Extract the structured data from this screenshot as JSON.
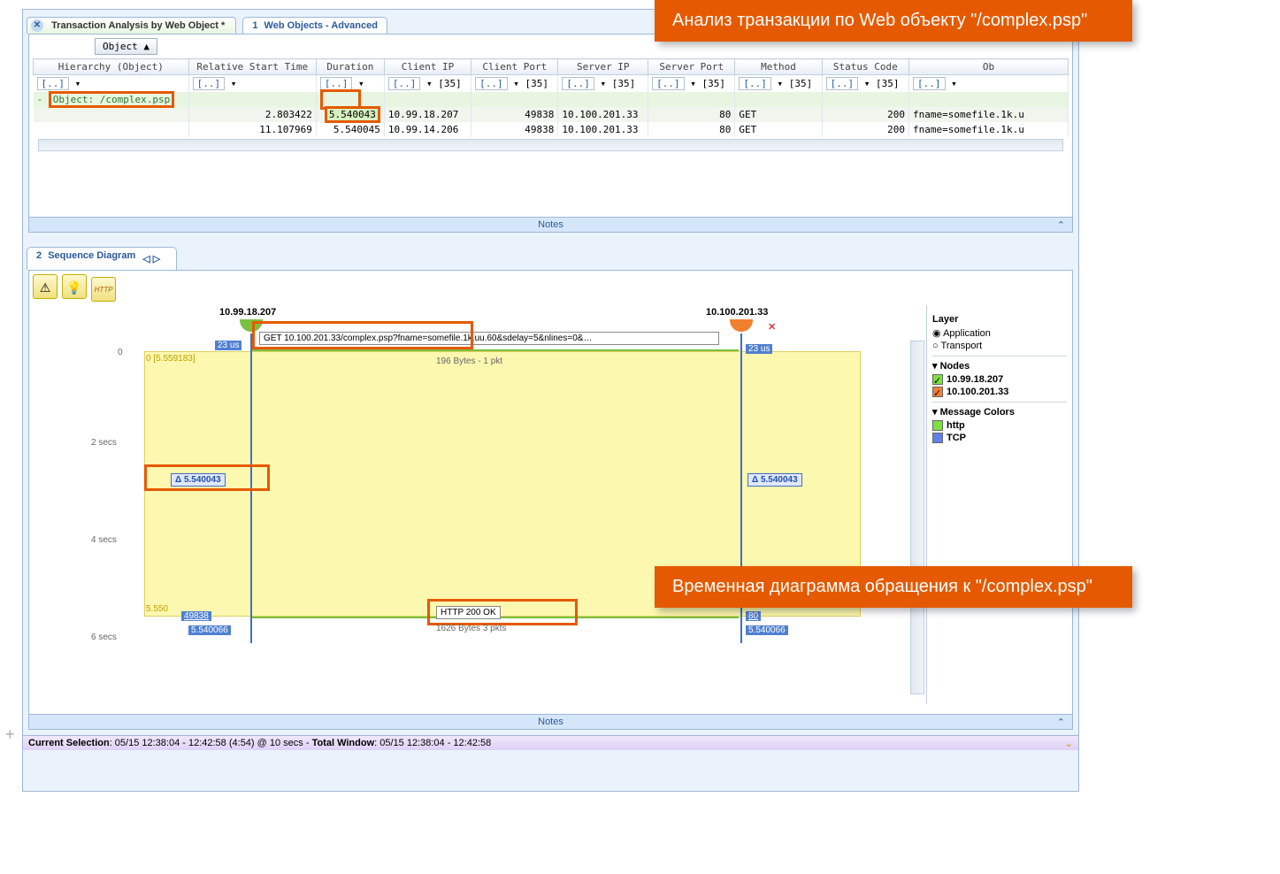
{
  "window_title": "Transaction Analysis by Web Object *",
  "panel1": {
    "tab_num": "1",
    "tab_label": "Web Objects - Advanced",
    "group_by": "Object  ▲",
    "columns": [
      "Hierarchy (Object)",
      "Relative Start Time",
      "Duration",
      "Client IP",
      "Client Port",
      "Server IP",
      "Server Port",
      "Method",
      "Status Code",
      "Ob"
    ],
    "filter_counts": [
      "",
      "",
      "",
      "[35]",
      "[35]",
      "[35]",
      "[35]",
      "[35]",
      "[35]",
      ""
    ],
    "group_row": "Object: /complex.psp",
    "rows": [
      {
        "rst": "2.803422",
        "dur": "5.540043",
        "cip": "10.99.18.207",
        "cport": "49838",
        "sip": "10.100.201.33",
        "sport": "80",
        "method": "GET",
        "status": "200",
        "obj": "fname=somefile.1k.u"
      },
      {
        "rst": "11.107969",
        "dur": "5.540045",
        "cip": "10.99.14.206",
        "cport": "49838",
        "sip": "10.100.201.33",
        "sport": "80",
        "method": "GET",
        "status": "200",
        "obj": "fname=somefile.1k.u"
      }
    ],
    "notes": "Notes"
  },
  "panel2": {
    "tab_num": "2",
    "tab_label": "Sequence Diagram",
    "layer_label": "Layer",
    "layer_app": "Application",
    "layer_trans": "Transport",
    "nodes_label": "Nodes",
    "node1": "10.99.18.207",
    "node2": "10.100.201.33",
    "msgcolors_label": "Message Colors",
    "mc_http": "http",
    "mc_tcp": "TCP",
    "diagram": {
      "node1_ip": "10.99.18.207",
      "node2_ip": "10.100.201.33",
      "y_ticks": [
        "0",
        "2 secs",
        "4 secs",
        "6 secs"
      ],
      "zone_start": "0 [5.559183]",
      "zone_end": "5.550",
      "req_label": "GET 10.100.201.33/complex.psp?fname=somefile.1k.uu.60&sdelay=5&nlines=0&…",
      "req_bytes": "196 Bytes - 1 pkt",
      "resp_label": "HTTP 200 OK",
      "resp_bytes": "1626 Bytes   3 pkts",
      "delta1": "Δ 5.540043",
      "delta2": "Δ 5.540043",
      "us1": "23 us",
      "us2": "23 us",
      "port1": "49838",
      "port2": "80",
      "time_end1": "5.540066",
      "time_end2": "5.540066"
    },
    "notes": "Notes"
  },
  "status": {
    "cs_label": "Current Selection",
    "cs_val": ": 05/15 12:38:04 - 12:42:58 (4:54) @ 10 secs  -  ",
    "tw_label": "Total Window",
    "tw_val": ": 05/15 12:38:04 - 12:42:58"
  },
  "callout1": "Анализ транзакции по Web объекту \"/complex.psp\"",
  "callout2": "Временная диаграмма обращения к \"/complex.psp\""
}
